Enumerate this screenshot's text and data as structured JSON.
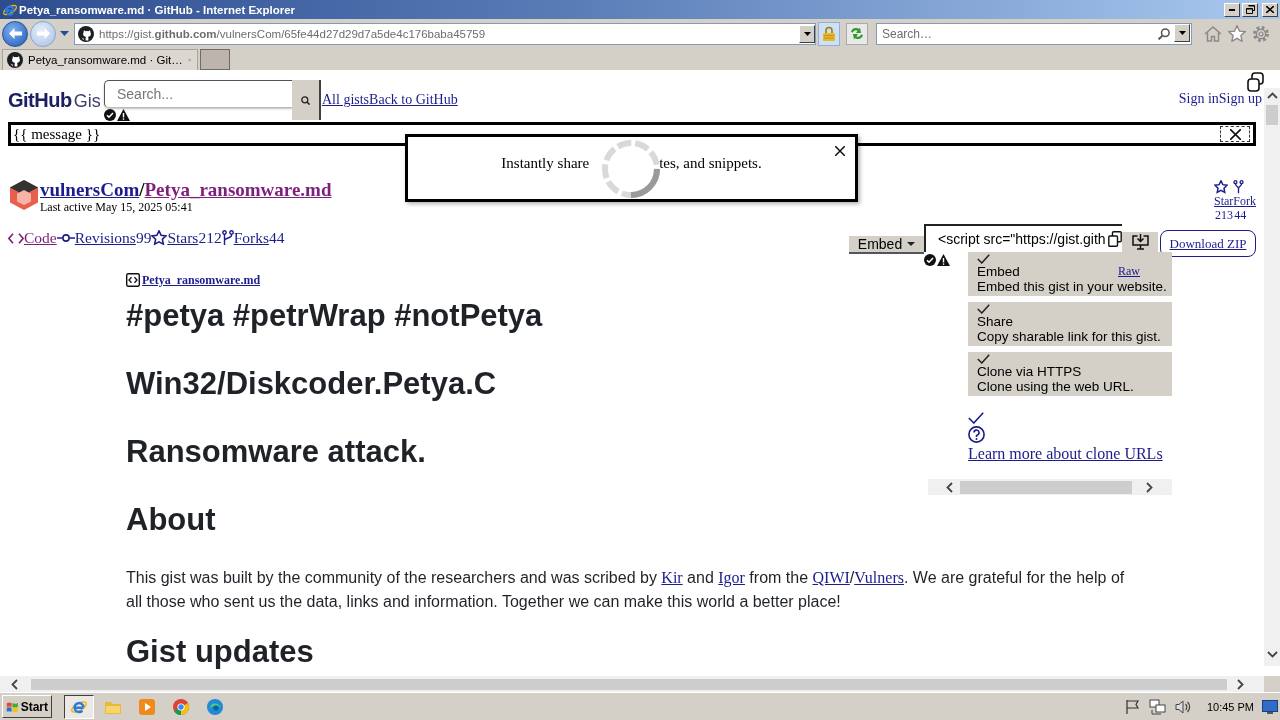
{
  "window": {
    "title": "Petya_ransomware.md · GitHub - Internet Explorer"
  },
  "address_bar": {
    "url": "https://gist.**github.com**/vulnersCom/65fe44d27d29d7a5de4c176baba45759"
  },
  "search_bar": {
    "placeholder": "Search…"
  },
  "tabs": [
    {
      "label": "Petya_ransomware.md · Git…",
      "selected": true
    }
  ],
  "page": {
    "header": {
      "logo": "GitHub",
      "logo_product": "Gis",
      "search_placeholder": "Search...",
      "links": [
        "All gists",
        "Back to GitHub"
      ],
      "auth_links": [
        "Sign in",
        "Sign up"
      ]
    },
    "message_bar": {
      "text": "{{ message }}"
    },
    "notice": {
      "text_before": "Instantly share",
      "text_after": "tes, and snippets."
    },
    "gist": {
      "owner": "vulnersCom",
      "separator": "/",
      "name": "Petya_ransomware.md",
      "last_active": "Last active May 15, 2025 05:41"
    },
    "gist_tabs": [
      {
        "label": "Code",
        "selected": true
      },
      {
        "label": "Revisions",
        "count": "99",
        "selected": false
      },
      {
        "label": "Stars",
        "count": "212",
        "selected": false
      },
      {
        "label": "Forks",
        "count": "44",
        "selected": false
      }
    ],
    "actions": [
      {
        "label": "Star",
        "count": "213"
      },
      {
        "label": "Fork",
        "count": "44"
      }
    ],
    "embed": {
      "menu_button": "Embed",
      "value": "<script src=\"https://gist.gith",
      "download_zip": "Download ZIP"
    },
    "clone_options": [
      {
        "title": "Embed",
        "description": "Embed this gist in your website.",
        "checked": true
      },
      {
        "title": "Share",
        "description": "Copy sharable link for this gist.",
        "checked": true
      },
      {
        "title": "Clone via HTTPS",
        "description": "Clone using the web URL.",
        "checked": true
      }
    ],
    "help_link": "Learn more about clone URLs",
    "file": {
      "name": "Petya_ransomware.md",
      "raw": "Raw"
    },
    "content": [
      {
        "kind": "heading",
        "text": "#petya #petrWrap #notPetya"
      },
      {
        "kind": "heading",
        "text": "Win32/Diskcoder.Petya.C"
      },
      {
        "kind": "heading",
        "text": "Ransomware attack."
      },
      {
        "kind": "heading",
        "text": "About"
      },
      {
        "kind": "paragraph",
        "parts": [
          {
            "kind": "text",
            "text": "This gist was built by the community of the researchers and was scribed by "
          },
          {
            "kind": "link",
            "text": "Kir"
          },
          {
            "kind": "text",
            "text": " and "
          },
          {
            "kind": "link",
            "text": "Igor"
          },
          {
            "kind": "text",
            "text": " from the "
          },
          {
            "kind": "link",
            "text": "QIWI"
          },
          {
            "kind": "text",
            "text": "/"
          },
          {
            "kind": "link",
            "text": "Vulners"
          },
          {
            "kind": "text",
            "text": ". We are grateful for the help of all those who sent us the data, links and information. Together we can make this world a better place!"
          }
        ]
      },
      {
        "kind": "heading",
        "text": "Gist updates"
      }
    ]
  },
  "taskbar": {
    "start": "Start",
    "clock": "10:45 PM"
  }
}
